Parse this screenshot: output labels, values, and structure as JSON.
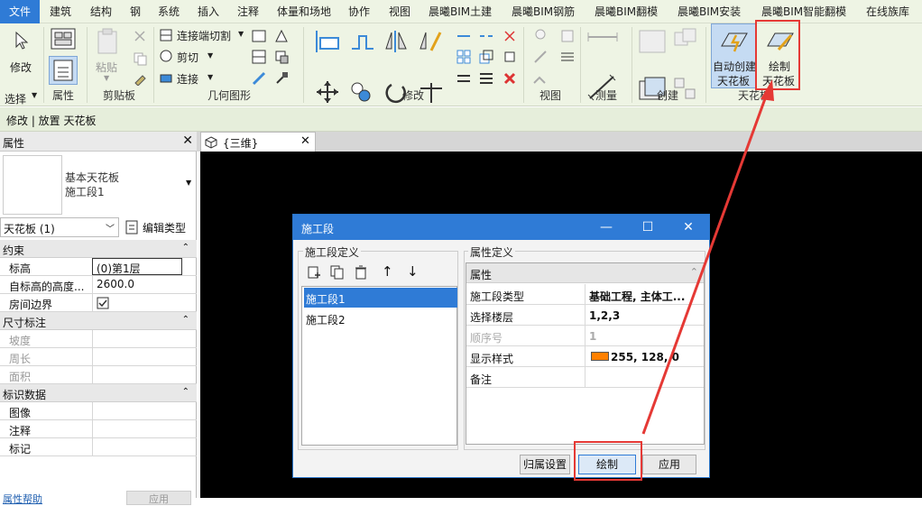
{
  "menu": {
    "file": "文件",
    "tabs": [
      "建筑",
      "结构",
      "钢",
      "系统",
      "插入",
      "注释",
      "体量和场地",
      "协作",
      "视图",
      "晨曦BIM土建",
      "晨曦BIM钢筋",
      "晨曦BIM翻模",
      "晨曦BIM安装",
      "晨曦BIM智能翻模",
      "在线族库"
    ]
  },
  "ribbon": {
    "modify_label": "修改",
    "paste_label": "粘贴",
    "cut_join": "连接端切割",
    "cut": "剪切",
    "join": "连接",
    "auto_ceiling": [
      "自动创建",
      "天花板"
    ],
    "draw_ceiling": [
      "绘制",
      "天花板"
    ],
    "groups": {
      "select": "选择",
      "properties": "属性",
      "clipboard": "剪贴板",
      "geometry": "几何图形",
      "modify": "修改",
      "view": "视图",
      "measure": "测量",
      "create": "创建",
      "ceiling": "天花板"
    }
  },
  "context_bar": "修改 | 放置 天花板",
  "properties": {
    "title": "属性",
    "type_name": "基本天花板",
    "type_sub": "施工段1",
    "selector": "天花板 (1)",
    "edit_type": "编辑类型",
    "sections": {
      "constraints": "约束",
      "dimensions": "尺寸标注",
      "identity": "标识数据"
    },
    "rows": {
      "level_k": "标高",
      "level_v": "(0)第1层",
      "offset_k": "自标高的高度...",
      "offset_v": "2600.0",
      "room_k": "房间边界",
      "slope_k": "坡度",
      "perimeter_k": "周长",
      "area_k": "面积",
      "image_k": "图像",
      "comment_k": "注释",
      "mark_k": "标记"
    },
    "help": "属性帮助",
    "apply": "应用"
  },
  "view_tab": "{三维}",
  "dialog": {
    "title": "施工段",
    "left_group": "施工段定义",
    "right_group": "属性定义",
    "items": [
      "施工段1",
      "施工段2"
    ],
    "prop_header": "属性",
    "props": [
      {
        "k": "施工段类型",
        "v": "基础工程, 主体工..."
      },
      {
        "k": "选择楼层",
        "v": "1,2,3"
      },
      {
        "k": "顺序号",
        "v": "1"
      },
      {
        "k": "显示样式",
        "v": "255, 128, 0"
      },
      {
        "k": "备注",
        "v": ""
      }
    ],
    "style_color": "#ff8000",
    "btn_assign": "归属设置",
    "btn_draw": "绘制",
    "btn_apply": "应用"
  },
  "colors": {
    "accent": "#2f7bd6",
    "highlight": "#e53935"
  }
}
